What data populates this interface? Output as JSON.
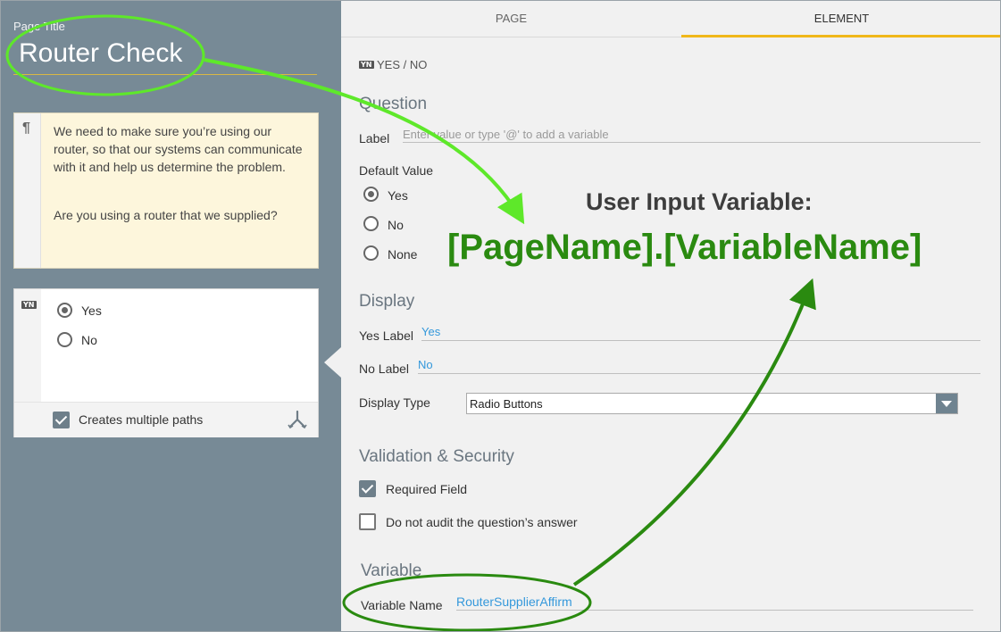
{
  "left": {
    "page_title_label": "Page Title",
    "page_title": "Router Check",
    "text_card": {
      "icon": "paragraph-icon",
      "paragraph1": "We need to make sure you’re using our router, so that our systems can communicate with it and help us determine the problem.",
      "paragraph2": "Are you using a router that we supplied?"
    },
    "yes_no_card": {
      "icon": "yes-no-icon",
      "icon_text": "YN",
      "options": [
        "Yes",
        "No"
      ],
      "selected": "Yes",
      "creates_multiple_paths_label": "Creates multiple paths",
      "creates_multiple_paths_checked": true
    }
  },
  "tabs": [
    "PAGE",
    "ELEMENT"
  ],
  "active_tab": "ELEMENT",
  "element": {
    "type_icon_text": "YN",
    "type_label": "YES / NO",
    "question": {
      "heading": "Question",
      "label_label": "Label",
      "label_placeholder": "Enter value or type '@' to add a variable",
      "default_value_label": "Default Value",
      "default_options": [
        "Yes",
        "No",
        "None"
      ],
      "default_selected": "Yes"
    },
    "display": {
      "heading": "Display",
      "yes_label_label": "Yes Label",
      "yes_label_value": "Yes",
      "no_label_label": "No Label",
      "no_label_value": "No",
      "display_type_label": "Display Type",
      "display_type_value": "Radio Buttons"
    },
    "validation": {
      "heading": "Validation & Security",
      "required_field_label": "Required Field",
      "required_field_checked": true,
      "no_audit_label": "Do not audit the question’s answer",
      "no_audit_checked": false
    },
    "variable": {
      "heading": "Variable",
      "variable_name_label": "Variable Name",
      "variable_name_value": "RouterSupplierAffirm"
    }
  },
  "annotation": {
    "title": "User Input Variable:",
    "pattern": "[PageName].[VariableName]",
    "colors": {
      "bright": "#5ee82a",
      "dark": "#2a8a10"
    }
  },
  "colors": {
    "left_panel": "#778a96",
    "card_bg": "#fdf6dc",
    "accent_tab": "#f0b81a",
    "link": "#3498db",
    "section_heading": "#6a7680"
  }
}
